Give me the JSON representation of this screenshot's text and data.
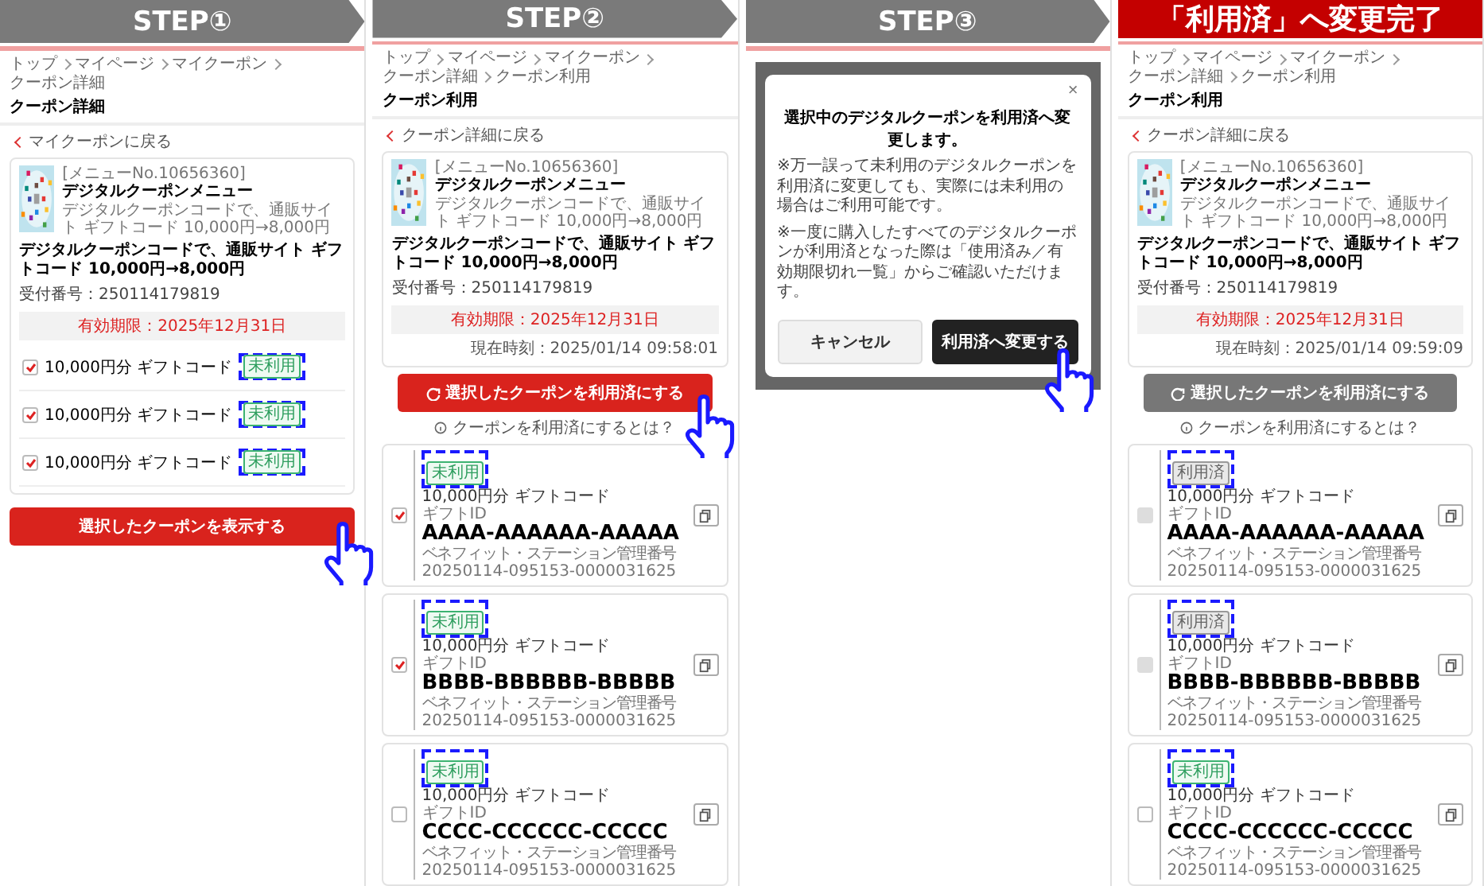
{
  "steps": [
    {
      "kind": "detail",
      "header": {
        "kind": "arrow",
        "label": "STEP①"
      },
      "breadcrumb": [
        "トップ",
        "マイページ",
        "マイクーポン",
        "クーポン詳細"
      ],
      "page_title": "クーポン詳細",
      "back_link": "マイクーポンに戻る",
      "product": {
        "menu_no": "[メニューNo.10656360]",
        "name": "デジタルクーポンメニュー",
        "description": "デジタルクーポンコードで、通販サイト ギフトコード 10,000円→8,000円",
        "title": "デジタルクーポンコードで、通販サイト ギフトコード 10,000円→8,000円",
        "receipt": "受付番号：250114179819"
      },
      "expiry": "有効期限：2025年12月31日",
      "items": [
        {
          "label": "10,000円分 ギフトコード",
          "checked": true,
          "badge": {
            "kind": "unused",
            "label": "未利用",
            "highlighted": true
          }
        },
        {
          "label": "10,000円分 ギフトコード",
          "checked": true,
          "badge": {
            "kind": "unused",
            "label": "未利用",
            "highlighted": true
          }
        },
        {
          "label": "10,000円分 ギフトコード",
          "checked": true,
          "badge": {
            "kind": "unused",
            "label": "未利用",
            "highlighted": true
          }
        }
      ],
      "button": {
        "label": "選択したクーポンを表示する",
        "disabled": false,
        "pointer": true
      }
    },
    {
      "kind": "use",
      "header": {
        "kind": "arrow",
        "label": "STEP②"
      },
      "breadcrumb": [
        "トップ",
        "マイページ",
        "マイクーポン",
        "クーポン詳細",
        "クーポン利用"
      ],
      "page_title": "クーポン利用",
      "back_link": "クーポン詳細に戻る",
      "product": {
        "menu_no": "[メニューNo.10656360]",
        "name": "デジタルクーポンメニュー",
        "description": "デジタルクーポンコードで、通販サイト ギフトコード 10,000円→8,000円",
        "title": "デジタルクーポンコードで、通販サイト ギフトコード 10,000円→8,000円",
        "receipt": "受付番号：250114179819"
      },
      "expiry": "有効期限：2025年12月31日",
      "current_time": "現在時刻：2025/01/14 09:58:01",
      "button": {
        "label": "選択したクーポンを利用済にする",
        "disabled": false,
        "pointer": true
      },
      "help": "クーポンを利用済にするとは？",
      "coupons": [
        {
          "badge": {
            "kind": "unused",
            "label": "未利用",
            "highlighted": true
          },
          "label": "10,000円分 ギフトコード",
          "id_label": "ギフトID",
          "code": "AAAA-AAAAAA-AAAAA",
          "mgmt_label": "ベネフィット・ステーション管理番号",
          "mgmt_no": "20250114-095153-0000031625",
          "checked": true,
          "disabled": false
        },
        {
          "badge": {
            "kind": "unused",
            "label": "未利用",
            "highlighted": true
          },
          "label": "10,000円分 ギフトコード",
          "id_label": "ギフトID",
          "code": "BBBB-BBBBBB-BBBBB",
          "mgmt_label": "ベネフィット・ステーション管理番号",
          "mgmt_no": "20250114-095153-0000031625",
          "checked": true,
          "disabled": false
        },
        {
          "badge": {
            "kind": "unused",
            "label": "未利用",
            "highlighted": true
          },
          "label": "10,000円分 ギフトコード",
          "id_label": "ギフトID",
          "code": "CCCC-CCCCCC-CCCCC",
          "mgmt_label": "ベネフィット・ステーション管理番号",
          "mgmt_no": "20250114-095153-0000031625",
          "checked": false,
          "disabled": false
        }
      ]
    },
    {
      "kind": "dialog",
      "header": {
        "kind": "arrow",
        "label": "STEP③"
      },
      "dialog": {
        "close": "×",
        "title": "選択中のデジタルクーポンを利用済へ変更します。",
        "body": [
          "※万一誤って未利用のデジタルクーポンを利用済に変更しても、実際には未利用の場合はご利用可能です。",
          "※一度に購入したすべてのデジタルクーポンが利用済となった際は「使用済み／有効期限切れ一覧」からご確認いただけます。"
        ],
        "buttons": [
          {
            "kind": "secondary",
            "label": "キャンセル"
          },
          {
            "kind": "primary",
            "label": "利用済へ変更する",
            "pointer": true
          }
        ]
      }
    },
    {
      "kind": "use",
      "header": {
        "kind": "final",
        "label": "「利用済」へ変更完了"
      },
      "breadcrumb": [
        "トップ",
        "マイページ",
        "マイクーポン",
        "クーポン詳細",
        "クーポン利用"
      ],
      "page_title": "クーポン利用",
      "back_link": "クーポン詳細に戻る",
      "product": {
        "menu_no": "[メニューNo.10656360]",
        "name": "デジタルクーポンメニュー",
        "description": "デジタルクーポンコードで、通販サイト ギフトコード 10,000円→8,000円",
        "title": "デジタルクーポンコードで、通販サイト ギフトコード 10,000円→8,000円",
        "receipt": "受付番号：250114179819"
      },
      "expiry": "有効期限：2025年12月31日",
      "current_time": "現在時刻：2025/01/14 09:59:09",
      "button": {
        "label": "選択したクーポンを利用済にする",
        "disabled": true
      },
      "help": "クーポンを利用済にするとは？",
      "coupons": [
        {
          "badge": {
            "kind": "used",
            "label": "利用済",
            "highlighted": true
          },
          "label": "10,000円分 ギフトコード",
          "id_label": "ギフトID",
          "code": "AAAA-AAAAAA-AAAAA",
          "mgmt_label": "ベネフィット・ステーション管理番号",
          "mgmt_no": "20250114-095153-0000031625",
          "checked": false,
          "disabled": true
        },
        {
          "badge": {
            "kind": "used",
            "label": "利用済",
            "highlighted": true
          },
          "label": "10,000円分 ギフトコード",
          "id_label": "ギフトID",
          "code": "BBBB-BBBBBB-BBBBB",
          "mgmt_label": "ベネフィット・ステーション管理番号",
          "mgmt_no": "20250114-095153-0000031625",
          "checked": false,
          "disabled": true
        },
        {
          "badge": {
            "kind": "unused",
            "label": "未利用",
            "highlighted": true
          },
          "label": "10,000円分 ギフトコード",
          "id_label": "ギフトID",
          "code": "CCCC-CCCCCC-CCCCC",
          "mgmt_label": "ベネフィット・ステーション管理番号",
          "mgmt_no": "20250114-095153-0000031625",
          "checked": false,
          "disabled": false
        }
      ]
    }
  ]
}
